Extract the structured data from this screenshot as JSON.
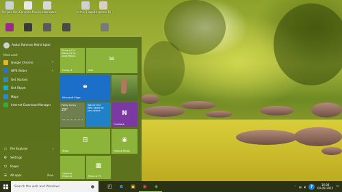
{
  "desktop_icons": [
    {
      "label": "Recycle Bin",
      "color": "#c8d0d8"
    },
    {
      "label": "Contains Pool 1",
      "color": "#e8e8e8"
    },
    {
      "label": "ncnsbc black apps",
      "color": "#d8d8d8"
    },
    {
      "label": "ncmic 1 apps",
      "color": "#d0d0d0"
    },
    {
      "label": "Hrspahrs 10 Guids",
      "color": "#d8d0c0"
    },
    {
      "label": "",
      "color": "#9a2a8a"
    },
    {
      "label": "",
      "color": "#3a3a3a"
    },
    {
      "label": "",
      "color": "#5a5a5a"
    },
    {
      "label": "",
      "color": "#4a4a4a"
    },
    {
      "label": "",
      "color": "#7a7a7a"
    }
  ],
  "start_menu": {
    "user_name": "Abdul Rahman Mohd Iqbal",
    "most_used_label": "Most used",
    "apps": [
      {
        "label": "Google Chrome",
        "color": "#e3b51f",
        "chevron": "›"
      },
      {
        "label": "WPS Writer",
        "color": "#2b73c9",
        "chevron": "›"
      },
      {
        "label": "Get Started",
        "color": "#1f8fdc",
        "chevron": ""
      },
      {
        "label": "Get Skype",
        "color": "#00aff0",
        "chevron": ""
      },
      {
        "label": "Maps",
        "color": "#2a8ad0",
        "chevron": ""
      },
      {
        "label": "Internet Download Manager",
        "color": "#38a83c",
        "chevron": ""
      }
    ],
    "bottom": [
      {
        "label": "File Explorer",
        "glyph": "▭",
        "extra": "›"
      },
      {
        "label": "Settings",
        "glyph": "⚙",
        "extra": ""
      },
      {
        "label": "Power",
        "glyph": "⏻",
        "extra": ""
      },
      {
        "label": "All apps",
        "glyph": "☰",
        "extra": "New"
      }
    ]
  },
  "tiles": {
    "mail_preview": "Richard C S\nDiscord's fo...\nDaily Boost...",
    "mail_day": "Friday 4",
    "mail": "Mail",
    "edge": "Microsoft Edge",
    "weather": "Partly Sunny",
    "weather_temp": "29°",
    "skype_preview": "Talk for free\nWith Skype on\nyour phone",
    "onenote": "OneNote",
    "store": "Store",
    "groove": "Groove Music",
    "optional": "Optional\nFeatures",
    "films": "Films & TV"
  },
  "taskbar": {
    "search_placeholder": "Search the web and Windows",
    "apps": [
      "◰",
      "e",
      "▣",
      "◉",
      "◈"
    ],
    "time": "16:04",
    "date": "04-09-2015"
  },
  "colors": {
    "start_bg": "#586e1c",
    "tile_green": "#8db43a",
    "tile_blue": "#1b6fc8",
    "taskbar": "#2a3115"
  }
}
